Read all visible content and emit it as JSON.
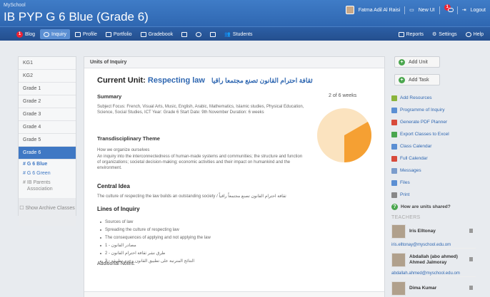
{
  "header": {
    "school": "MySchool",
    "title": "IB PYP G 6 Blue (Grade 6)",
    "user_name": "Fatma Adil Al Raisi",
    "new_ui": "New UI",
    "notif_count": "1",
    "logout": "Logout"
  },
  "nav": {
    "blog_badge": "1",
    "blog": "Blog",
    "inquiry": "Inquiry",
    "profile": "Profile",
    "portfolio": "Portfolio",
    "gradebook": "Gradebook",
    "students": "Students",
    "reports": "Reports",
    "settings": "Settings",
    "help": "Help"
  },
  "sidebar": {
    "items": [
      "KG1",
      "KG2",
      "Grade 1",
      "Grade 2",
      "Grade 3",
      "Grade 4",
      "Grade 5",
      "Grade 6"
    ],
    "subs": [
      {
        "hash": "#",
        "label": "G 6 Blue"
      },
      {
        "hash": "#",
        "label": "G 6 Green"
      },
      {
        "hash": "#",
        "label": "IB Parents Association"
      }
    ],
    "archive": "Show Archive Classes"
  },
  "main": {
    "header": "Units of Inquiry",
    "current_unit_prefix": "Current Unit:",
    "unit_name": "Respecting law",
    "unit_name_ar": "ثقافة احترام القانون تصنع مجتمعا راقيا",
    "summary_h": "Summary",
    "weeks": "2 of 6 weeks",
    "summary_text": "Subject Focus: French, Visual Arts, Music, English, Arabic, Mathematics, Islamic studies, Physical Education, Science, Social Studies, ICT   Year: Grade 6   Start Date: 9th November   Duration: 6 weeks",
    "theme_h": "Transdisciplinary Theme",
    "theme_name": "How we organize ourselves",
    "theme_text": "An inquiry into the interconnectedness of human-made systems and communities; the structure and function of organizations; societal decision-making; economic activities and their impact on humankind and the environment.",
    "central_h": "Central Idea",
    "central_text": "The culture of respecting the law builds an outstanding society / ثقافة احترام القانون تصنع مجتمعاً راقياً",
    "lines_h": "Lines of Inquiry",
    "lines": [
      "Sources of law",
      "Spreading the culture of respecting law",
      "The consequences of applying and not applying the law",
      "1 - مصادر القانون",
      "2 - طرق نشر ثقافة احترام القانون",
      "3 - النتائج المترتبة على تطبيق القانون وعدم تطبيقه"
    ],
    "additional_h": "Additional Notes:"
  },
  "chart_data": {
    "type": "pie",
    "values": [
      2,
      4
    ],
    "colors": [
      "#f5a033",
      "#fbe3bf"
    ]
  },
  "right": {
    "add_unit": "Add Unit",
    "add_task": "Add Task",
    "links": [
      {
        "label": "Add Resources",
        "color": "#8ab43c"
      },
      {
        "label": "Programme of Inquiry",
        "color": "#5b8fd3"
      },
      {
        "label": "Generate PDF Planner",
        "color": "#d84a3a"
      },
      {
        "label": "Export Classes to Excel",
        "color": "#4aa64e"
      },
      {
        "label": "Class Calendar",
        "color": "#5b8fd3"
      },
      {
        "label": "Full Calendar",
        "color": "#d84a3a"
      },
      {
        "label": "Messages",
        "color": "#7a9ccc"
      },
      {
        "label": "Files",
        "color": "#5b8fd3"
      },
      {
        "label": "Print",
        "color": "#888888"
      }
    ],
    "shared_q": "How are units shared?",
    "teachers_h": "TEACHERS",
    "teachers": [
      {
        "name": "Iris Elltonay",
        "email": "iris.elltonay@myschool.edu.om"
      },
      {
        "name": "Abdallah (abo ahmed) Ahmed Jalmoray",
        "email": "abdallah.ahmed@myschool.edu.om"
      },
      {
        "name": "Dima Kumar",
        "email": ""
      }
    ]
  }
}
